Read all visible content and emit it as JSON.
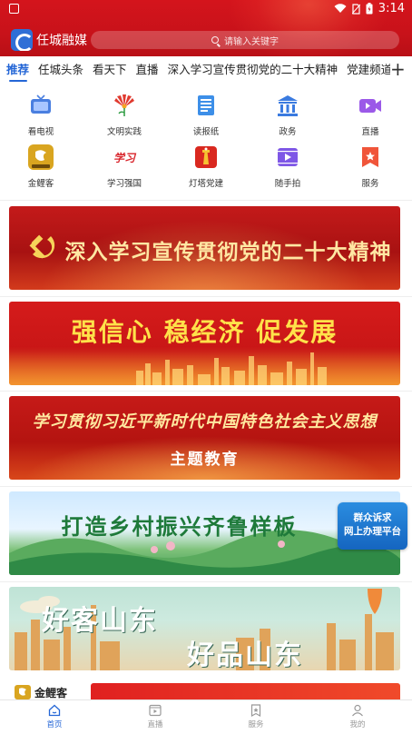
{
  "status_bar": {
    "time": "3:14"
  },
  "header": {
    "app_name": "任城融媒",
    "search_placeholder": "请输入关键字"
  },
  "tabs": [
    "推荐",
    "任城头条",
    "看天下",
    "直播",
    "深入学习宣传贯彻党的二十大精神",
    "党建频道"
  ],
  "tab_add": "+",
  "grid": [
    {
      "label": "看电视",
      "icon": "tv-icon"
    },
    {
      "label": "文明实践",
      "icon": "fan-flower-icon"
    },
    {
      "label": "读报纸",
      "icon": "newspaper-icon"
    },
    {
      "label": "政务",
      "icon": "government-building-icon"
    },
    {
      "label": "直播",
      "icon": "video-camera-icon"
    },
    {
      "label": "金鲤客",
      "icon": "jinlike-app-icon"
    },
    {
      "label": "学习强国",
      "icon": "xuexi-qiangguo-icon"
    },
    {
      "label": "灯塔党建",
      "icon": "lighthouse-icon"
    },
    {
      "label": "随手拍",
      "icon": "film-play-icon"
    },
    {
      "label": "服务",
      "icon": "bookmark-star-icon"
    }
  ],
  "banners": [
    {
      "line1": "深入学习宣传贯彻党的二十大精神"
    },
    {
      "line1": "强信心  稳经济  促发展"
    },
    {
      "line1": "学习贯彻习近平新时代中国特色社会主义思想",
      "line2": "主题教育"
    },
    {
      "line1": "打造乡村振兴齐鲁样板"
    },
    {
      "line1": "好客山东",
      "line2": "好品山东"
    },
    {
      "logo_text": "金鲤客"
    }
  ],
  "floating_badge": {
    "line1": "群众诉求",
    "line2": "网上办理平台"
  },
  "bottom_nav": [
    "首页",
    "直播",
    "服务",
    "我的"
  ]
}
